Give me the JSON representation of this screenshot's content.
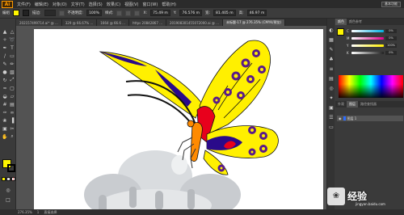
{
  "app": {
    "logo": "Ai"
  },
  "menu": {
    "items": [
      "文件(F)",
      "编辑(E)",
      "对象(O)",
      "文字(T)",
      "选择(S)",
      "效果(C)",
      "视图(V)",
      "窗口(W)",
      "帮助(H)"
    ],
    "workspace": "基本功能"
  },
  "control": {
    "mode": "编组",
    "stroke_label": "描边:",
    "stroke_value": "",
    "opacity_label": "不透明度:",
    "opacity_value": "100%",
    "style_label": "样式:",
    "x_label": "X:",
    "x_value": "75.49 m",
    "y_label": "Y:",
    "y_value": "76.576 m",
    "w_label": "宽:",
    "w_value": "81.405 m",
    "h_label": "高:",
    "h_value": "46.97 m"
  },
  "tabs": [
    "202157499714.ai* @ ...",
    "329 @ 66.67% ...",
    "1664 @ 66.6 ...",
    "https 20842867 ...",
    "201908301455072000.ai @ ...",
    "未标题-17 @ 276.35% (CMYK/预览)"
  ],
  "panels": {
    "color_tabs": [
      "颜色",
      "颜色参考"
    ],
    "sliders": [
      {
        "label": "C",
        "value": "0%",
        "color": "#00b0e0"
      },
      {
        "label": "M",
        "value": "0%",
        "color": "#e0008a"
      },
      {
        "label": "Y",
        "value": "100%",
        "color": "#ffee00"
      },
      {
        "label": "K",
        "value": "0%",
        "color": "#222222"
      }
    ],
    "layers_tabs": [
      "外观",
      "图层",
      "路径查找器"
    ],
    "layer_name": "图层 1"
  },
  "status": {
    "zoom": "276.35%",
    "page": "1",
    "tool": "直接选择"
  },
  "watermark": {
    "text": "经验",
    "url": "jingyan.baidu.com"
  },
  "colors": {
    "fill": "#fff600",
    "stroke": "#000000",
    "accent": "#ff9a00"
  }
}
